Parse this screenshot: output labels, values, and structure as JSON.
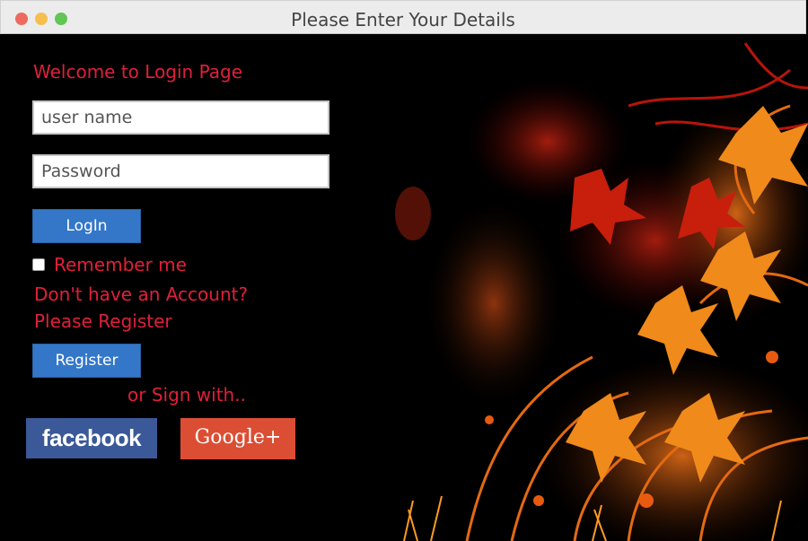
{
  "window": {
    "title": "Please Enter Your Details"
  },
  "login": {
    "heading": "Welcome to Login Page",
    "username_placeholder": "user name",
    "password_placeholder": "Password",
    "login_button": "LogIn",
    "remember_label": "Remember me",
    "no_account_text": "Don't have an Account?",
    "please_register_text": "Please Register",
    "register_button": "Register",
    "sign_with_text": "or Sign with..",
    "facebook_label": "facebook",
    "google_label": "Google+"
  },
  "colors": {
    "accent_red": "#e0203a",
    "button_blue": "#3477c8",
    "facebook_blue": "#3b5998",
    "google_red": "#dc4e34"
  }
}
